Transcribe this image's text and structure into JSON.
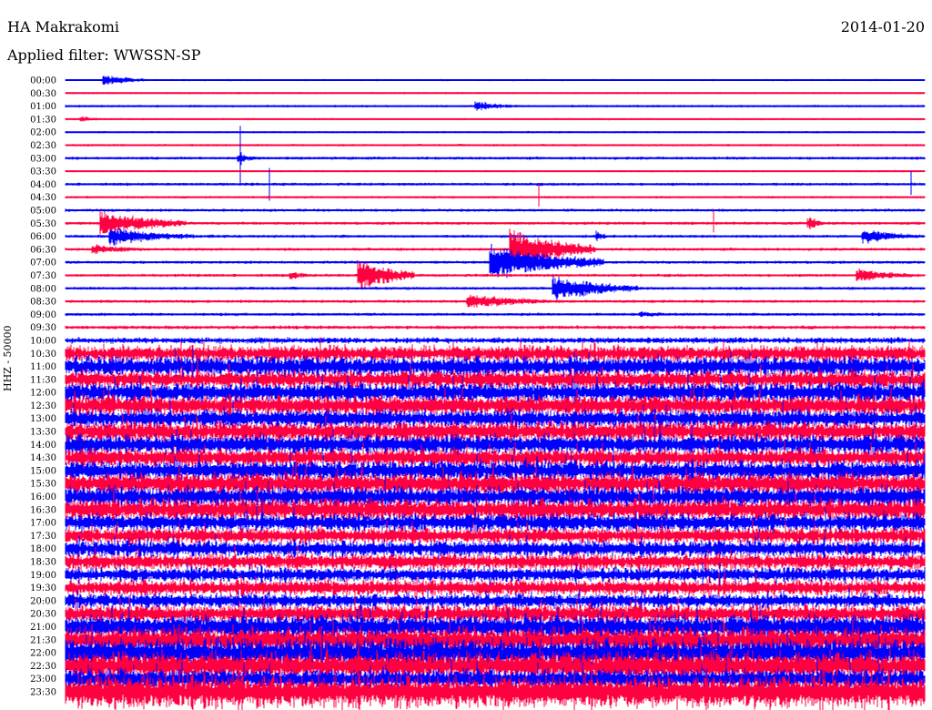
{
  "header": {
    "station": "HA Makrakomi",
    "filter": "Applied filter: WWSSN-SP",
    "date": "2014-01-20"
  },
  "chart_data": {
    "type": "line",
    "title": "HA Makrakomi",
    "ylabel": "HHZ - 50000",
    "colors": [
      "#0000ff",
      "#ff0040"
    ],
    "row_minutes": 30,
    "row_labels": [
      "00:00",
      "00:30",
      "01:00",
      "01:30",
      "02:00",
      "02:30",
      "03:00",
      "03:30",
      "04:00",
      "04:30",
      "05:00",
      "05:30",
      "06:00",
      "06:30",
      "07:00",
      "07:30",
      "08:00",
      "08:30",
      "09:00",
      "09:30",
      "10:00",
      "10:30",
      "11:00",
      "11:30",
      "12:00",
      "12:30",
      "13:00",
      "13:30",
      "14:00",
      "14:30",
      "15:00",
      "15:30",
      "16:00",
      "16:30",
      "17:00",
      "17:30",
      "18:00",
      "18:30",
      "19:00",
      "19:30",
      "20:00",
      "20:30",
      "21:00",
      "21:30",
      "22:00",
      "22:30",
      "23:00",
      "23:30"
    ],
    "noise_level": [
      1,
      1,
      1.2,
      1,
      1,
      1.2,
      1.5,
      1,
      1.5,
      1.2,
      1.5,
      1.5,
      1.5,
      1.5,
      1.5,
      1.5,
      1.5,
      1.5,
      1.5,
      1.8,
      3,
      8,
      10,
      9,
      10,
      10,
      9,
      10,
      10,
      9,
      10,
      11,
      10,
      11,
      9,
      8,
      8,
      8,
      7,
      8,
      7,
      9,
      12,
      13,
      14,
      14,
      10,
      16
    ],
    "events": [
      {
        "row": 0,
        "minute": 1.3,
        "amp": 8,
        "duration": 1.5
      },
      {
        "row": 2,
        "minute": 14.3,
        "amp": 7,
        "duration": 1.5
      },
      {
        "row": 3,
        "minute": 0.5,
        "amp": 4,
        "duration": 1
      },
      {
        "row": 6,
        "minute": 6.0,
        "amp": 6,
        "duration": 1
      },
      {
        "row": 11,
        "minute": 1.2,
        "amp": 16,
        "duration": 3
      },
      {
        "row": 12,
        "minute": 1.5,
        "amp": 12,
        "duration": 3
      },
      {
        "row": 13,
        "minute": 0.9,
        "amp": 7,
        "duration": 2
      },
      {
        "row": 12,
        "minute": 27.8,
        "amp": 10,
        "duration": 2
      },
      {
        "row": 14,
        "minute": 14.8,
        "amp": 22,
        "duration": 4
      },
      {
        "row": 13,
        "minute": 15.5,
        "amp": 24,
        "duration": 3
      },
      {
        "row": 15,
        "minute": 10.2,
        "amp": 20,
        "duration": 2
      },
      {
        "row": 15,
        "minute": 7.8,
        "amp": 6,
        "duration": 1
      },
      {
        "row": 15,
        "minute": 27.6,
        "amp": 10,
        "duration": 2
      },
      {
        "row": 16,
        "minute": 17.0,
        "amp": 16,
        "duration": 3
      },
      {
        "row": 17,
        "minute": 14.0,
        "amp": 10,
        "duration": 3
      },
      {
        "row": 18,
        "minute": 20.0,
        "amp": 4,
        "duration": 2
      },
      {
        "row": 6,
        "minute": 6.1,
        "amp": 40,
        "duration": 0.05
      },
      {
        "row": 8,
        "minute": 7.1,
        "amp": 40,
        "duration": 0.05
      },
      {
        "row": 9,
        "minute": 16.5,
        "amp": 45,
        "duration": 0.05
      },
      {
        "row": 11,
        "minute": 22.6,
        "amp": 50,
        "duration": 0.05
      },
      {
        "row": 8,
        "minute": 29.5,
        "amp": 40,
        "duration": 0.05
      },
      {
        "row": 11,
        "minute": 25.9,
        "amp": 10,
        "duration": 0.6
      },
      {
        "row": 12,
        "minute": 18.5,
        "amp": 8,
        "duration": 0.5
      }
    ]
  }
}
